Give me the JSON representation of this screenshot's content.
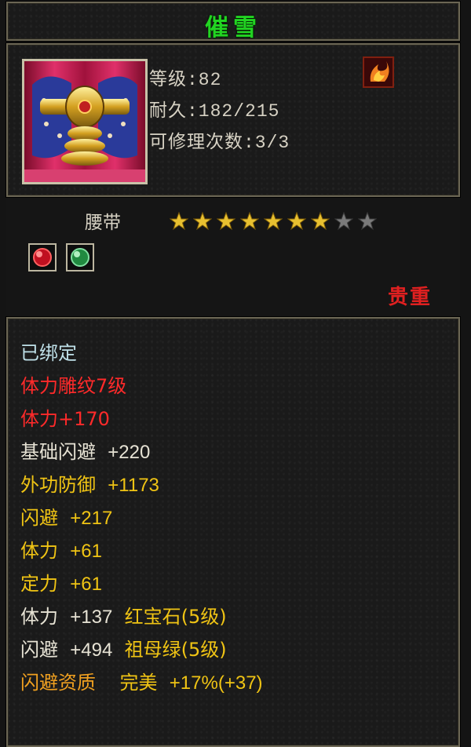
{
  "item": {
    "name": "催雪",
    "level_label": "等级:82",
    "durability_label": "耐久:182/215",
    "repair_label": "可修理次数:3/3",
    "type": "腰带",
    "stars_filled": 7,
    "stars_total": 9,
    "rarity": "贵重"
  },
  "attributes": [
    {
      "label": "已绑定",
      "value": "",
      "extra": ""
    },
    {
      "label": "体力雕纹7级",
      "value": "",
      "extra": ""
    },
    {
      "label": "体力+170",
      "value": "",
      "extra": ""
    },
    {
      "label": "基础闪避",
      "value": "+220",
      "extra": ""
    },
    {
      "label": "外功防御",
      "value": "+1173",
      "extra": ""
    },
    {
      "label": "闪避",
      "value": "+217",
      "extra": ""
    },
    {
      "label": "体力",
      "value": "+61",
      "extra": ""
    },
    {
      "label": "定力",
      "value": "+61",
      "extra": ""
    },
    {
      "label": "体力",
      "value": "+137",
      "extra": "红宝石(5级)"
    },
    {
      "label": "闪避",
      "value": "+494",
      "extra": "祖母绿(5级)"
    },
    {
      "label": "闪避资质",
      "value": "完美",
      "extra": "+17%(+37)"
    }
  ],
  "colors": {
    "title": "#22d422",
    "gold": "#f0c414",
    "red": "#ff2a2a",
    "orange": "#f0a020",
    "rarity": "#e02020"
  },
  "icons": {
    "item": "belt-icon",
    "badge": "flame-emblem-icon",
    "gem1": "ruby-gem-icon",
    "gem2": "emerald-gem-icon",
    "star": "star-icon"
  }
}
